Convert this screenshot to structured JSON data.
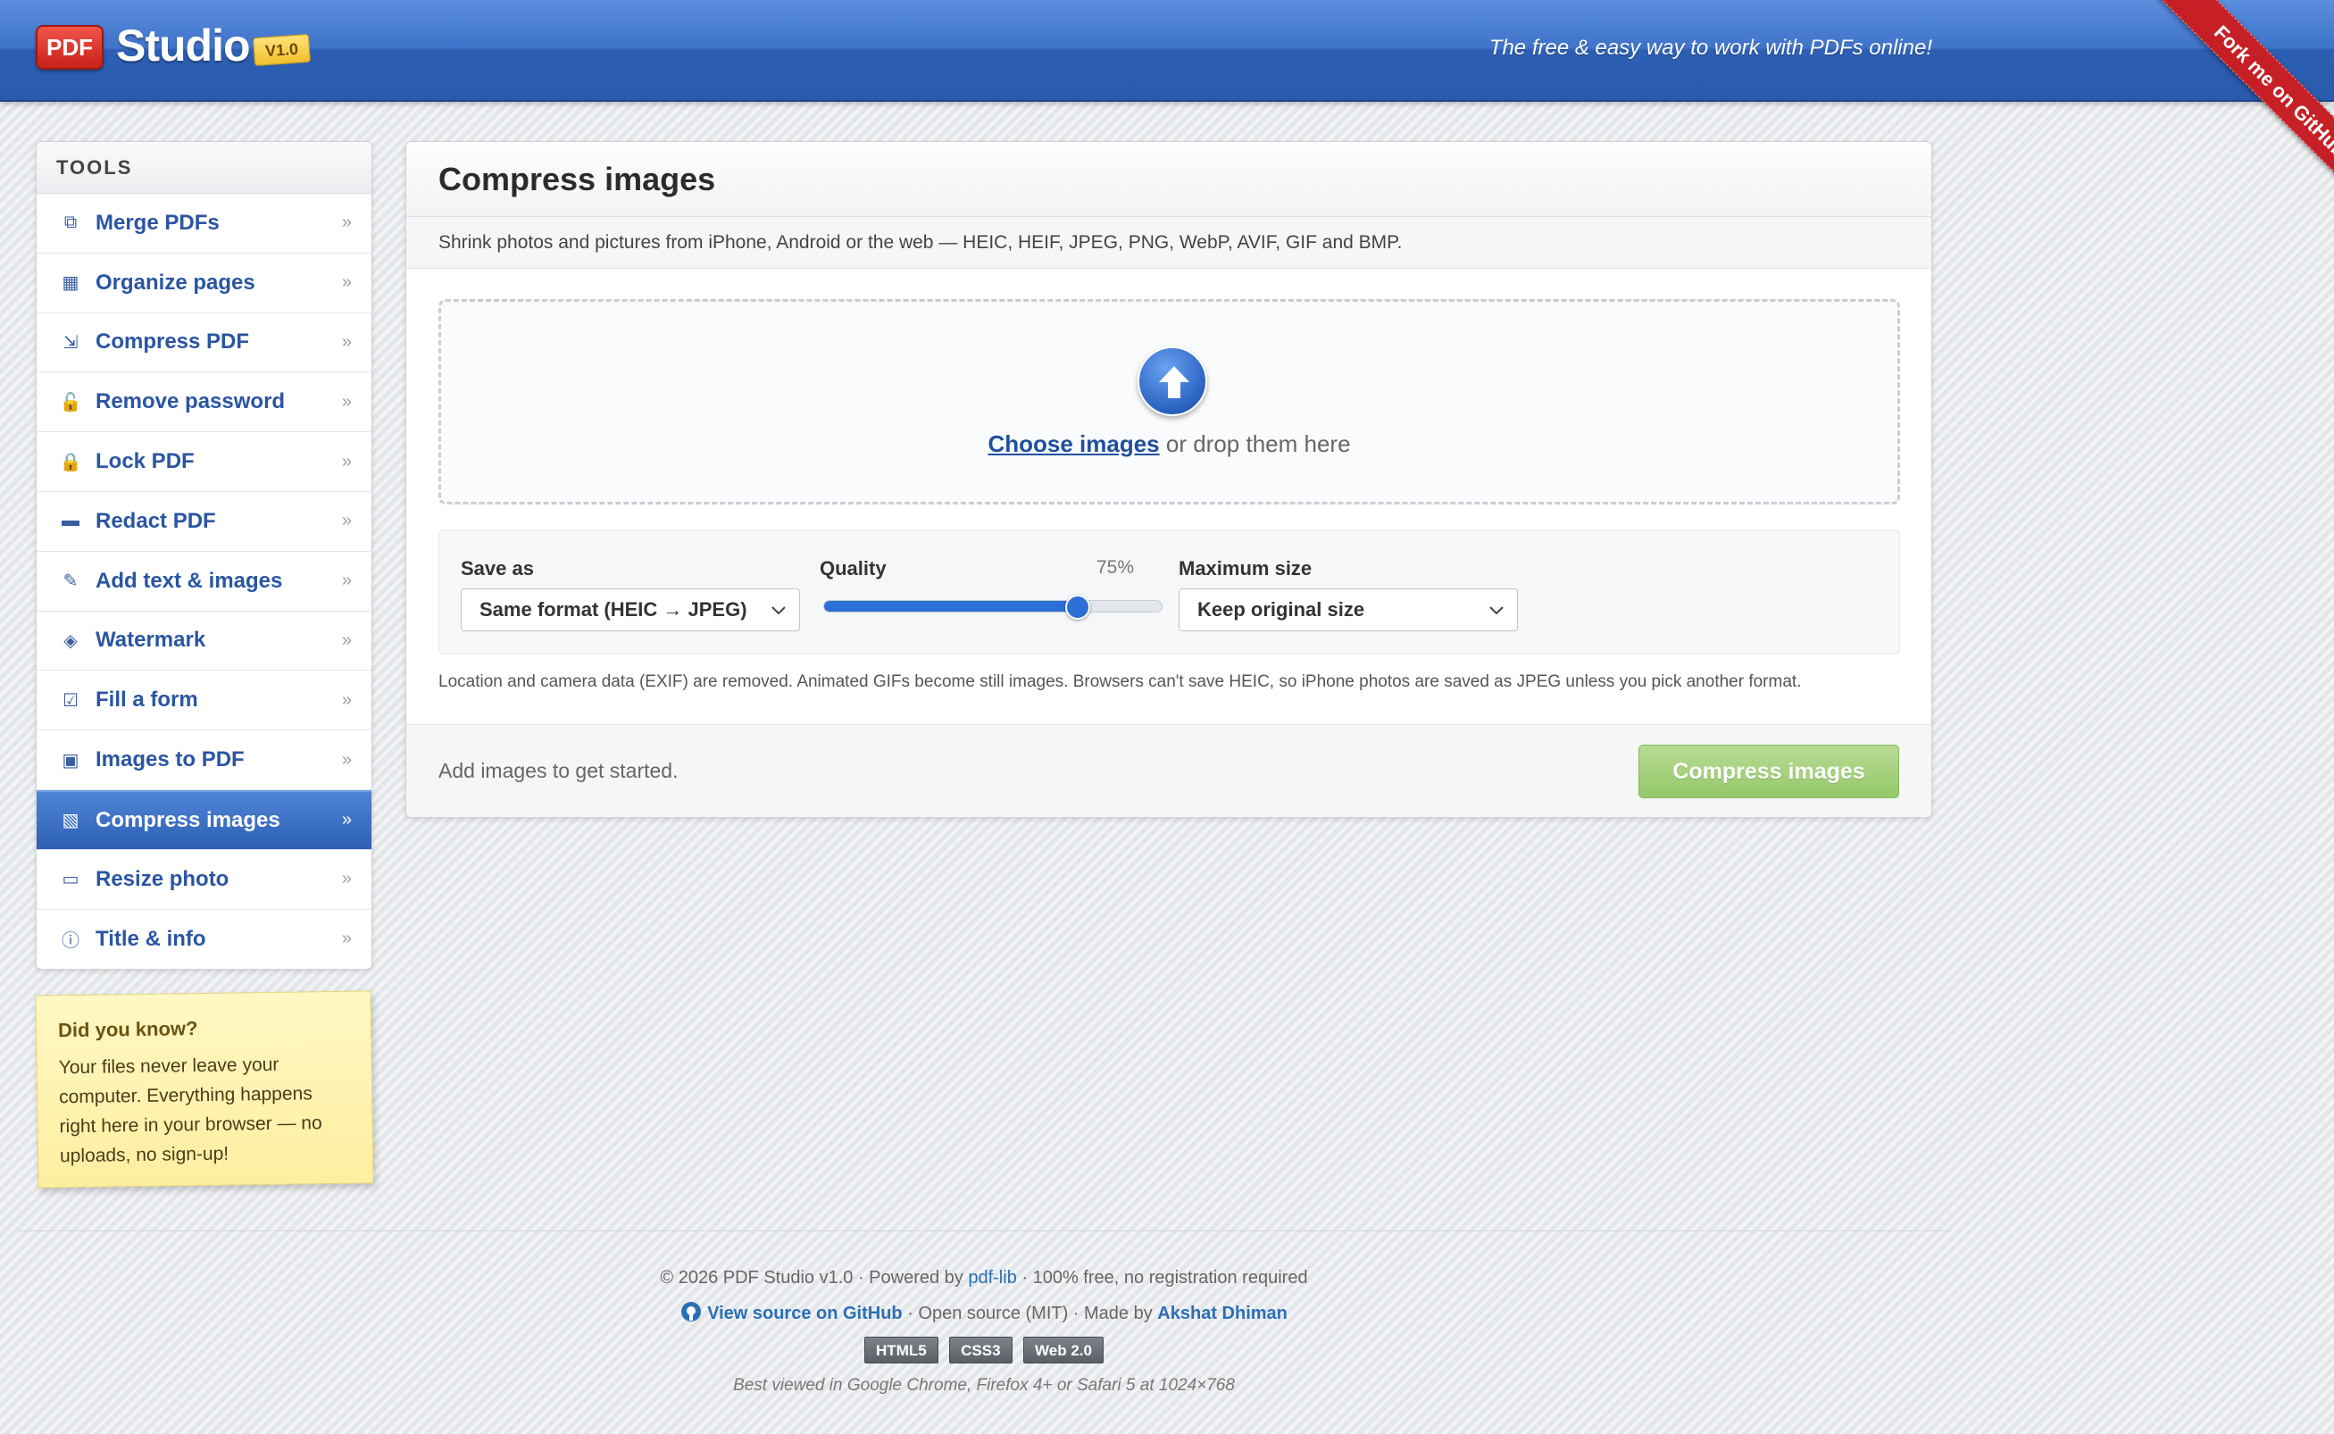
{
  "header": {
    "logo_badge": "PDF",
    "logo_text": "Studio",
    "version": "V1.0",
    "tagline": "The free & easy way to work with PDFs online!",
    "ribbon": "Fork me on GitHub"
  },
  "sidebar": {
    "title": "TOOLS",
    "items": [
      {
        "label": "Merge PDFs",
        "icon": "⧉",
        "chevron": "»"
      },
      {
        "label": "Organize pages",
        "icon": "▦",
        "chevron": "»"
      },
      {
        "label": "Compress PDF",
        "icon": "⇲",
        "chevron": "»"
      },
      {
        "label": "Remove password",
        "icon": "🔓",
        "chevron": "»"
      },
      {
        "label": "Lock PDF",
        "icon": "🔒",
        "chevron": "»"
      },
      {
        "label": "Redact PDF",
        "icon": "▬",
        "chevron": "»"
      },
      {
        "label": "Add text & images",
        "icon": "✎",
        "chevron": "»"
      },
      {
        "label": "Watermark",
        "icon": "◈",
        "chevron": "»"
      },
      {
        "label": "Fill a form",
        "icon": "☑",
        "chevron": "»"
      },
      {
        "label": "Images to PDF",
        "icon": "▣",
        "chevron": "»"
      },
      {
        "label": "Compress images",
        "icon": "▧",
        "chevron": "»",
        "active": true
      },
      {
        "label": "Resize photo",
        "icon": "▭",
        "chevron": "»"
      },
      {
        "label": "Title & info",
        "icon": "ⓘ",
        "chevron": "»"
      }
    ]
  },
  "note": {
    "title": "Did you know?",
    "body": "Your files never leave your computer. Everything happens right here in your browser — no uploads, no sign-up!"
  },
  "panel": {
    "title": "Compress images",
    "subtitle": "Shrink photos and pictures from iPhone, Android or the web — HEIC, HEIF, JPEG, PNG, WebP, AVIF, GIF and BMP.",
    "dropzone": {
      "link": "Choose images",
      "text": " or drop them here"
    },
    "options": {
      "save_as_label": "Save as",
      "save_as_value": "Same format (HEIC → JPEG)",
      "quality_label": "Quality",
      "quality_value": "75%",
      "quality_fraction": 0.75,
      "max_size_label": "Maximum size",
      "max_size_value": "Keep original size"
    },
    "info": "Location and camera data (EXIF) are removed. Animated GIFs become still images. Browsers can't save HEIC, so iPhone photos are saved as JPEG unless you pick another format.",
    "status": "Add images to get started.",
    "button": "Compress images"
  },
  "footer": {
    "copyright_pre": "© 2026 PDF Studio v1.0 · Powered by ",
    "powered_link": "pdf-lib",
    "copyright_post": " · 100% free, no registration required",
    "source_link": "View source on GitHub",
    "license_text": " · Open source (MIT) · Made by ",
    "author": "Akshat Dhiman",
    "badges": [
      "HTML5",
      "CSS3",
      "Web 2.0"
    ],
    "best_viewed": "Best viewed in Google Chrome, Firefox 4+ or Safari 5 at 1024×768"
  },
  "colors": {
    "header_blue": "#3f73c9",
    "active_nav": "#2c5fb4",
    "link_blue": "#2a55a3",
    "button_green": "#94c86a",
    "ribbon_red": "#c62026"
  }
}
